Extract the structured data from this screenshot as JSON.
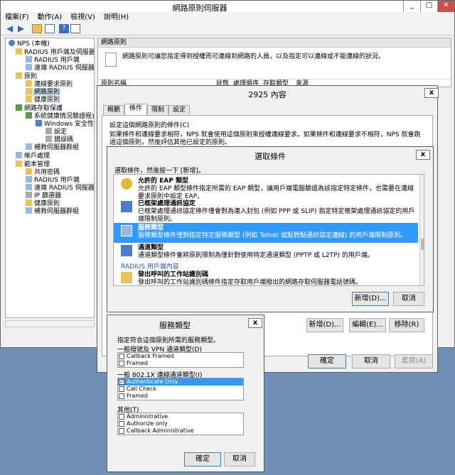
{
  "main_window": {
    "title": "網路原則伺服器",
    "menu": [
      "檔案(F)",
      "動作(A)",
      "檢視(V)",
      "說明(H)"
    ],
    "tree": [
      {
        "label": "NPS (本機)"
      },
      {
        "label": "RADIUS 用戶端及伺服器"
      },
      {
        "label": "RADIUS 用戶端"
      },
      {
        "label": "遠端 RADIUS 伺服器群"
      },
      {
        "label": "原則"
      },
      {
        "label": "連線要求原則"
      },
      {
        "label": "網路原則"
      },
      {
        "label": "健康原則"
      },
      {
        "label": "網路存取保護"
      },
      {
        "label": "系統健康情況驗證程式"
      },
      {
        "label": "Windows 安全性健"
      },
      {
        "label": "設定"
      },
      {
        "label": "錯誤碼"
      },
      {
        "label": "補救伺服器群組"
      },
      {
        "label": "帳戶處理"
      },
      {
        "label": "範本管理"
      },
      {
        "label": "共用密碼"
      },
      {
        "label": "RADIUS 用戶端"
      },
      {
        "label": "遠端 RADIUS 伺服器"
      },
      {
        "label": "IP 篩選器"
      },
      {
        "label": "健康原則"
      },
      {
        "label": "補救伺服器群組"
      }
    ],
    "right_header": "網路原則",
    "right_description": "網路原則可讓您指定得到授權而可連線到網路的人員，以及指定可以連線或不能連線的狀況。",
    "columns": [
      "原則名稱",
      "狀態",
      "處理順序",
      "存取類型",
      "來源"
    ]
  },
  "properties_dialog": {
    "title": "2925 內容",
    "tabs": [
      "概觀",
      "條件",
      "限制",
      "設定"
    ],
    "active_tab": "條件",
    "label": "設定這個網路原則的條件(C)",
    "info": "如果條件和連線要求相符，NPS 就會使用這個原則來授權連線要求。如果條件和連線要求不相符，NPS 就會跳過這個原則，然後評估其他已設定的原則。",
    "buttons": {
      "add": "新增(D)...",
      "edit": "編輯(E)...",
      "remove": "移除(R)",
      "ok": "確定",
      "cancel": "取消",
      "apply": "套用(A)"
    }
  },
  "select_condition_dialog": {
    "title": "選取條件",
    "hint": "選取條件，然後按一下 [新增]。",
    "items": [
      {
        "title": "允許的 EAP 類型",
        "desc": "允許的 EAP 類型條件指定所需的 EAP 類型，讓用戶端電腦驗證為該指定特定條件，也需要在連線要求原則中設定 EAP。",
        "selected": false
      },
      {
        "title": "已框架處理通訊協定",
        "desc": "已框架處理通訊協定條件僅會對為連入封包 (例如 PPP 或 SLIP) 指定特定框架處理通訊協定的用戶端限制原則。",
        "selected": false
      },
      {
        "title": "服務類型",
        "desc": "服務類型條件僅對指定特定服務類型 (例如 Telnet 或點對點通訊協定連線) 的用戶端限制原則。",
        "selected": true
      },
      {
        "title": "通道類型",
        "desc": "通道類型條件會將原則限制為僅針對使用特定通道類型 (PPTP 或 L2TP) 的用戶端。",
        "selected": false
      }
    ],
    "group_label": "RADIUS 用戶端內容",
    "last_item": {
      "title": "發出呼叫的工作站識別碼",
      "desc": "發出呼叫的工作站識別碼條件指定存取用戶端撥出的網路存取伺服器電話號碼。"
    },
    "buttons": {
      "add": "新增(D)...",
      "cancel": "取消"
    }
  },
  "service_type_dialog": {
    "title": "服務類型",
    "instruction": "指定符合這個原則所需的服務類型。",
    "group1_label": "一般撥號及 VPN 通道類型(D)",
    "group1_items": [
      {
        "label": "Callback Framed",
        "checked": false
      },
      {
        "label": "Framed",
        "checked": false
      }
    ],
    "group2_label": "一般 802.1X 連線通道類型(I)",
    "group2_items": [
      {
        "label": "Authenticate Only",
        "checked": true,
        "selected": true
      },
      {
        "label": "Call Check",
        "checked": false
      },
      {
        "label": "Framed",
        "checked": false
      }
    ],
    "group3_label": "其他(T)",
    "group3_items": [
      {
        "label": "Administrative",
        "checked": false
      },
      {
        "label": "Authorize only",
        "checked": false
      },
      {
        "label": "Callback Administrative",
        "checked": false
      }
    ],
    "buttons": {
      "ok": "確定",
      "cancel": "取消"
    }
  },
  "colors": {
    "selection": "#3399ff",
    "desktop": "#6f8fb5"
  }
}
